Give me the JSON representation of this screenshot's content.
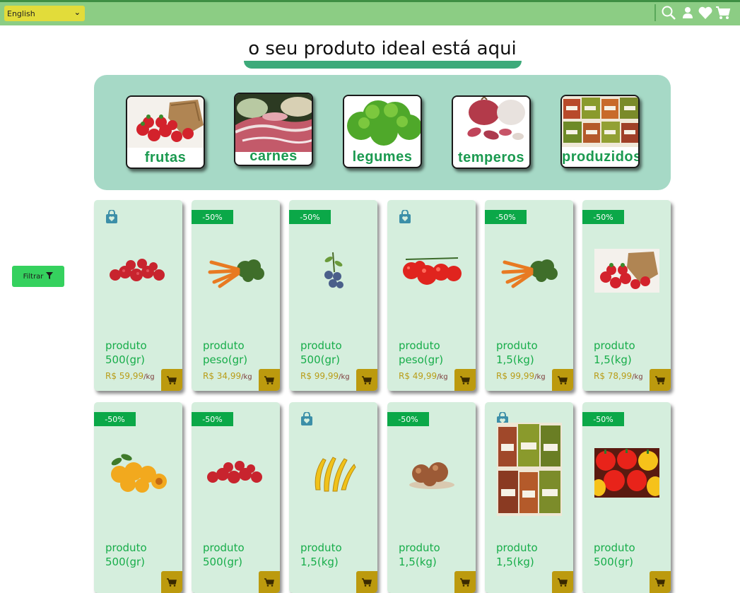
{
  "header": {
    "language": "English",
    "icons": [
      "search-icon",
      "user-icon",
      "heart-icon",
      "cart-icon"
    ]
  },
  "title": "o seu produto ideal está aqui",
  "categories": [
    {
      "label": "frutas",
      "image": "strawberries"
    },
    {
      "label": "carnes",
      "image": "meat"
    },
    {
      "label": "legumes",
      "image": "lettuce"
    },
    {
      "label": "temperos",
      "image": "garlic"
    },
    {
      "label": "produzidos",
      "image": "jars"
    }
  ],
  "filter": {
    "label": "Filtrar",
    "icon": "filter-icon"
  },
  "products": [
    {
      "badge": "",
      "bag": true,
      "name": "produto 500(gr)",
      "price": "R$ 59,99",
      "unit": "/kg",
      "image": "raspberries"
    },
    {
      "badge": "-50%",
      "bag": false,
      "name": "produto peso(gr)",
      "price": "R$ 34,99",
      "unit": "/kg",
      "image": "carrots"
    },
    {
      "badge": "-50%",
      "bag": false,
      "name": "produto 500(gr)",
      "price": "R$ 99,99",
      "unit": "/kg",
      "image": "blueberries"
    },
    {
      "badge": "",
      "bag": true,
      "name": "produto peso(gr)",
      "price": "R$ 49,99",
      "unit": "/kg",
      "image": "tomatoes"
    },
    {
      "badge": "-50%",
      "bag": false,
      "name": "produto 1,5(kg)",
      "price": "R$ 99,99",
      "unit": "/kg",
      "image": "carrots"
    },
    {
      "badge": "-50%",
      "bag": false,
      "name": "produto 1,5(kg)",
      "price": "R$ 78,99",
      "unit": "/kg",
      "image": "strawberries"
    },
    {
      "badge": "-50%",
      "bag": false,
      "name": "produto 500(gr)",
      "price": "",
      "unit": "",
      "image": "apricots"
    },
    {
      "badge": "-50%",
      "bag": false,
      "name": "produto 500(gr)",
      "price": "",
      "unit": "",
      "image": "raspberries"
    },
    {
      "badge": "",
      "bag": true,
      "name": "produto 1,5(kg)",
      "price": "",
      "unit": "",
      "image": "bananas"
    },
    {
      "badge": "-50%",
      "bag": false,
      "name": "produto 1,5(kg)",
      "price": "",
      "unit": "",
      "image": "onions"
    },
    {
      "badge": "",
      "bag": true,
      "name": "produto 1,5(kg)",
      "price": "",
      "unit": "",
      "image": "jars"
    },
    {
      "badge": "-50%",
      "bag": false,
      "name": "produto 500(gr)",
      "price": "",
      "unit": "",
      "image": "peppers"
    }
  ],
  "colors": {
    "header": "#8ccd84",
    "language_select": "#e2dc3a",
    "panel": "#a6d9c6",
    "card": "#d5eedd",
    "badge": "#0ba848",
    "name": "#17ad4a",
    "price": "#b99d18",
    "cart_button": "#bc9a0e",
    "filter_button": "#35d15e"
  }
}
